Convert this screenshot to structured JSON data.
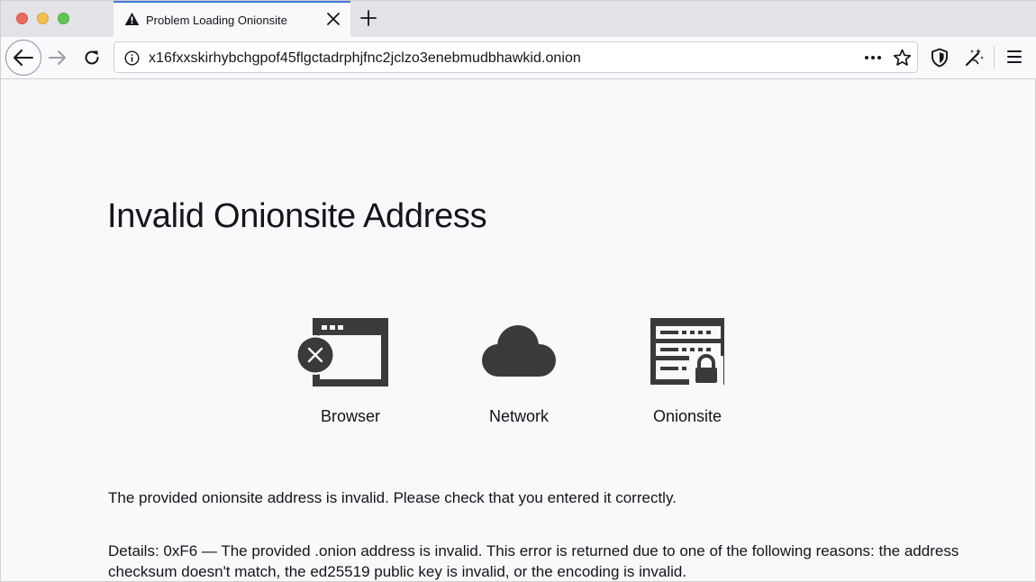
{
  "tab": {
    "title": "Problem Loading Onionsite"
  },
  "urlbar": {
    "url": "x16fxxskirhybchgpof45flgctadrphjfnc2jclzo3enebmudbhawkid.onion"
  },
  "main": {
    "heading": "Invalid Onionsite Address",
    "diagram": {
      "browser_label": "Browser",
      "network_label": "Network",
      "onionsite_label": "Onionsite"
    },
    "message": "The provided onionsite address is invalid. Please check that you entered it correctly.",
    "details": "Details: 0xF6 — The provided .onion address is invalid. This error is returned due to one of the following reasons: the address checksum doesn't match, the ed25519 public key is invalid, or the encoding is invalid."
  },
  "colors": {
    "accent": "#3d78d8",
    "icon_dark": "#3a3a3d",
    "text": "#15141a"
  }
}
